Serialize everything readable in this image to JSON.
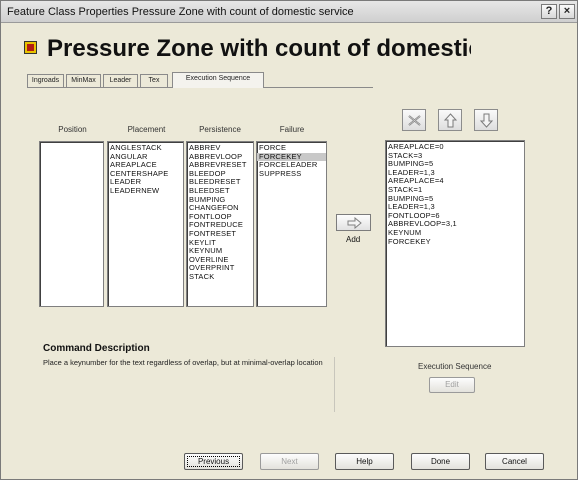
{
  "window": {
    "title": "Feature Class Properties   Pressure Zone with count of domestic service"
  },
  "titlebar": {
    "help_label": "?",
    "close_label": "×"
  },
  "header": {
    "title": "Pressure Zone with count of domestic service",
    "icon": "feature-class-icon"
  },
  "tabs": [
    {
      "label": "Ingroads",
      "active": false
    },
    {
      "label": "MinMax",
      "active": false
    },
    {
      "label": "Leader",
      "active": false
    },
    {
      "label": "Tex",
      "active": false
    },
    {
      "label": "Execution Sequence",
      "active": true
    }
  ],
  "columns": {
    "position": {
      "label": "Position",
      "items": []
    },
    "placement": {
      "label": "Placement",
      "items": [
        "ANGLESTACK",
        "ANGULAR",
        "AREAPLACE",
        "CENTERSHAPE",
        "LEADER",
        "LEADERNEW"
      ]
    },
    "persistence": {
      "label": "Persistence",
      "items": [
        "ABBREV",
        "ABBREVLOOP",
        "ABBREVRESET",
        "BLEEDOP",
        "BLEEDRESET",
        "BLEEDSET",
        "BUMPING",
        "CHANGEFON",
        "FONTLOOP",
        "FONTREDUCE",
        "FONTRESET",
        "KEYLIT",
        "KEYNUM",
        "OVERLINE",
        "OVERPRINT",
        "STACK"
      ]
    },
    "failure": {
      "label": "Failure",
      "items": [
        "FORCE",
        "FORCEKEY",
        "FORCELEADER",
        "SUPPRESS"
      ],
      "selected_index": 1
    }
  },
  "add_button": {
    "label": "Add",
    "icon": "arrow-right-icon"
  },
  "sequence_tools": {
    "delete_icon": "delete-icon",
    "up_icon": "arrow-up-icon",
    "down_icon": "arrow-down-icon"
  },
  "execution_sequence": {
    "items": [
      "AREAPLACE=0",
      "STACK=3",
      "BUMPING=5",
      "LEADER=1,3",
      "AREAPLACE=4",
      "STACK=1",
      "BUMPING=5",
      "LEADER=1,3",
      "FONTLOOP=6",
      "ABBREVLOOP=3,1",
      "KEYNUM",
      "FORCEKEY"
    ],
    "label": "Execution Sequence",
    "edit_label": "Edit"
  },
  "command_description": {
    "title": "Command Description",
    "text": "Place a keynumber for the text regardless of overlap, but at minimal-overlap location"
  },
  "footer": {
    "previous_label": "Previous",
    "next_label": "Next",
    "help_label": "Help",
    "done_label": "Done",
    "cancel_label": "Cancel"
  }
}
